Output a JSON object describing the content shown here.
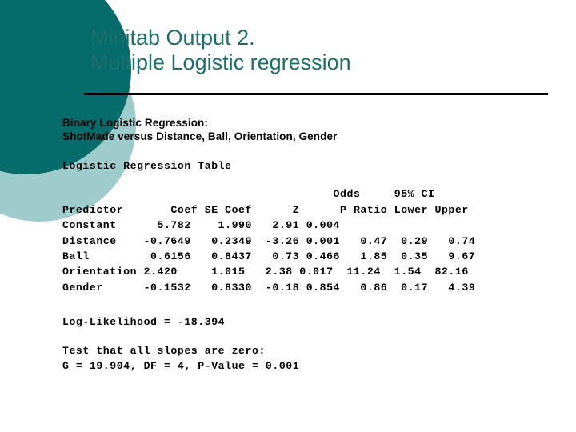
{
  "slide": {
    "title_lines": [
      "Minitab Output 2.",
      "Multiple Logistic regression"
    ],
    "title_color": "#1d6f6f",
    "rule_color": "#000000",
    "decoration": {
      "dark_circle_color": "#066b6b",
      "light_circle_color": "#9ecbcb"
    },
    "output": {
      "heading_line1": "Binary Logistic Regression:",
      "heading_line2": "ShotMade versus Distance, Ball, Orientation, Gender",
      "table_caption": "Logistic Regression Table",
      "header_top": "                                        Odds     95% CI",
      "header_main": "Predictor       Coef SE Coef      Z      P Ratio Lower Upper",
      "rows": [
        "Constant      5.782    1.990   2.91 0.004",
        "Distance    -0.7649   0.2349  -3.26 0.001   0.47  0.29   0.74",
        "Ball         0.6156   0.8437   0.73 0.466   1.85  0.35   9.67",
        "Orientation 2.420     1.015   2.38 0.017  11.24  1.54  82.16",
        "Gender      -0.1532   0.8330  -0.18 0.854   0.86  0.17   4.39"
      ],
      "log_likelihood": "Log-Likelihood = -18.394",
      "test_caption": "Test that all slopes are zero:",
      "test_values": "G = 19.904, DF = 4, P-Value = 0.001"
    },
    "table_data": {
      "columns": [
        "Predictor",
        "Coef",
        "SE Coef",
        "Z",
        "P",
        "Odds Ratio",
        "95% CI Lower",
        "95% CI Upper"
      ],
      "rows": [
        {
          "predictor": "Constant",
          "coef": "5.782",
          "se_coef": "1.990",
          "z": "2.91",
          "p": "0.004",
          "odds_ratio": "",
          "ci_lower": "",
          "ci_upper": ""
        },
        {
          "predictor": "Distance",
          "coef": "-0.7649",
          "se_coef": "0.2349",
          "z": "-3.26",
          "p": "0.001",
          "odds_ratio": "0.47",
          "ci_lower": "0.29",
          "ci_upper": "0.74"
        },
        {
          "predictor": "Ball",
          "coef": "0.6156",
          "se_coef": "0.8437",
          "z": "0.73",
          "p": "0.466",
          "odds_ratio": "1.85",
          "ci_lower": "0.35",
          "ci_upper": "9.67"
        },
        {
          "predictor": "Orientation",
          "coef": "2.420",
          "se_coef": "1.015",
          "z": "2.38",
          "p": "0.017",
          "odds_ratio": "11.24",
          "ci_lower": "1.54",
          "ci_upper": "82.16"
        },
        {
          "predictor": "Gender",
          "coef": "-0.1532",
          "se_coef": "0.8330",
          "z": "-0.18",
          "p": "0.854",
          "odds_ratio": "0.86",
          "ci_lower": "0.17",
          "ci_upper": "4.39"
        }
      ]
    }
  }
}
